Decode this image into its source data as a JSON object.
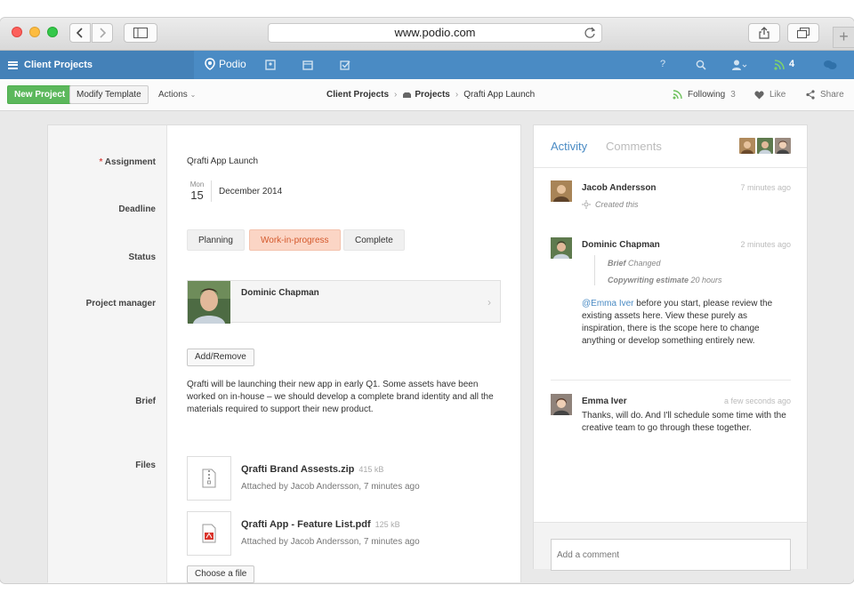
{
  "browser": {
    "url": "www.podio.com"
  },
  "topnav": {
    "workspace": "Client Projects",
    "logo": "Podio",
    "help": "?",
    "notifications_count": "4"
  },
  "toolbar": {
    "new_project": "New Project",
    "modify_template": "Modify Template",
    "actions": "Actions",
    "breadcrumb": [
      "Client Projects",
      "Projects",
      "Qrafti App Launch"
    ],
    "following_label": "Following",
    "following_count": "3",
    "like": "Like",
    "share": "Share"
  },
  "fields": {
    "assignment_label": "Assignment",
    "assignment_value": "Qrafti App Launch",
    "deadline_label": "Deadline",
    "deadline_weekday": "Mon",
    "deadline_day": "15",
    "deadline_month_year": "December 2014",
    "status_label": "Status",
    "status_options": [
      "Planning",
      "Work-in-progress",
      "Complete"
    ],
    "status_selected": "Work-in-progress",
    "pm_label": "Project manager",
    "pm_name": "Dominic Chapman",
    "add_remove": "Add/Remove",
    "brief_label": "Brief",
    "brief_text": "Qrafti will be launching their new app in early Q1. Some assets have been worked on in-house – we should develop a complete brand identity and all the materials required to support their new product.",
    "files_label": "Files",
    "files": [
      {
        "name": "Qrafti Brand Assests.zip",
        "size": "415 kB",
        "meta": "Attached by Jacob Andersson, 7 minutes ago"
      },
      {
        "name": "Qrafti App - Feature List.pdf",
        "size": "125 kB",
        "meta": "Attached by Jacob Andersson, 7 minutes ago"
      }
    ],
    "choose_file": "Choose a file"
  },
  "activity": {
    "tab_activity": "Activity",
    "tab_comments": "Comments",
    "entries": [
      {
        "name": "Jacob Andersson",
        "time": "7 minutes ago",
        "note": "Created this"
      },
      {
        "name": "Dominic Chapman",
        "time": "2 minutes ago",
        "change1_field": "Brief",
        "change1_text": "Changed",
        "change2_field": "Copywriting estimate",
        "change2_text": "20 hours",
        "mention": "@Emma Iver",
        "message": " before you start, please review the existing assets here. View these purely as inspiration, there is the scope here to change anything or develop something entirely new."
      },
      {
        "name": "Emma Iver",
        "time": "a few seconds ago",
        "message": "Thanks, will do. And I'll schedule some time with the creative team to go through these together."
      }
    ],
    "comment_placeholder": "Add a comment"
  },
  "colors": {
    "nav_blue": "#4a8bc4",
    "green": "#5cb85c",
    "status_active_bg": "#fbd5c5",
    "status_active_fg": "#d4582b"
  }
}
